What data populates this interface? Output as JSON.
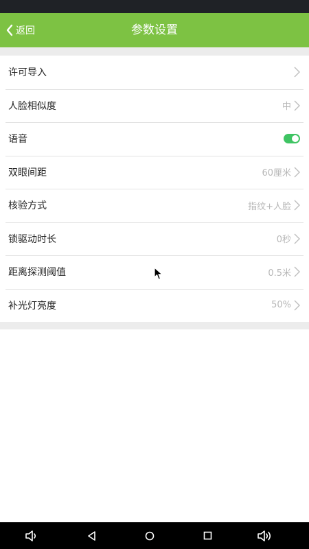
{
  "colors": {
    "accent": "#7dc243",
    "toggle_on": "#3fc463"
  },
  "header": {
    "back_label": "返回",
    "back_icon": "chevron-left-icon",
    "title": "参数设置"
  },
  "settings": [
    {
      "label": "许可导入",
      "value": ""
    },
    {
      "label": "人脸相似度",
      "value": "中"
    },
    {
      "label": "语音",
      "toggle": true
    },
    {
      "label": "双眼间距",
      "value": "60厘米"
    },
    {
      "label": "核验方式",
      "value": "指纹+人脸"
    },
    {
      "label": "锁驱动时长",
      "value": "0秒"
    },
    {
      "label": "距离探测阈值",
      "value": "0.5米"
    },
    {
      "label": "补光灯亮度",
      "value": "50%"
    }
  ],
  "nav_bar": {
    "buttons": [
      "volume-down-icon",
      "back-triangle-icon",
      "home-circle-icon",
      "recents-square-icon",
      "volume-up-icon"
    ]
  }
}
